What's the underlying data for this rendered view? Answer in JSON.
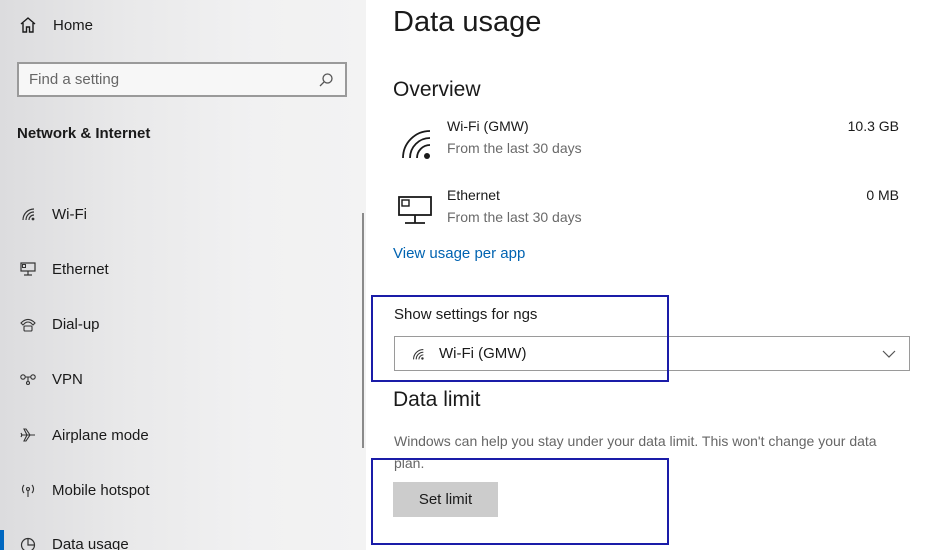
{
  "sidebar": {
    "home_label": "Home",
    "search_placeholder": "Find a setting",
    "section_title": "Network & Internet",
    "items": [
      {
        "label": "Wi-Fi",
        "icon": "wifi-icon"
      },
      {
        "label": "Ethernet",
        "icon": "ethernet-icon"
      },
      {
        "label": "Dial-up",
        "icon": "dialup-icon"
      },
      {
        "label": "VPN",
        "icon": "vpn-icon"
      },
      {
        "label": "Airplane mode",
        "icon": "airplane-icon"
      },
      {
        "label": "Mobile hotspot",
        "icon": "hotspot-icon"
      },
      {
        "label": "Data usage",
        "icon": "data-usage-icon",
        "selected": true
      }
    ]
  },
  "main": {
    "title": "Data usage",
    "overview": {
      "heading": "Overview",
      "rows": [
        {
          "name": "Wi-Fi (GMW)",
          "sub": "From the last 30 days",
          "amount": "10.3 GB",
          "icon": "wifi-icon"
        },
        {
          "name": "Ethernet",
          "sub": "From the last 30 days",
          "amount": "0 MB",
          "icon": "ethernet-icon"
        }
      ],
      "link": "View usage per app"
    },
    "show_settings": {
      "label": "Show settings for ngs",
      "selected": "Wi-Fi (GMW)"
    },
    "data_limit": {
      "heading": "Data limit",
      "description": "Windows can help you stay under your data limit. This won't change your data plan.",
      "button": "Set limit"
    }
  },
  "colors": {
    "accent": "#0067c0",
    "link": "#0063b1",
    "highlight_box": "#1a1ca8"
  }
}
